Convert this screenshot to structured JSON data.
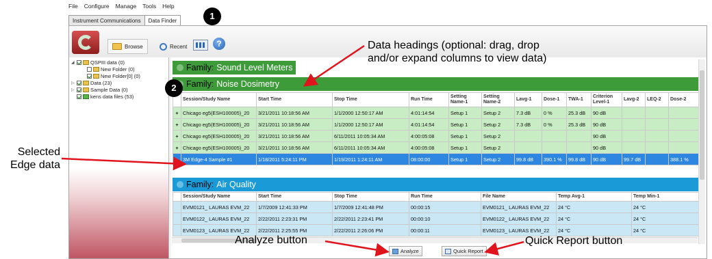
{
  "menu": [
    "File",
    "Configure",
    "Manage",
    "Tools",
    "Help"
  ],
  "tabs": [
    "Instrument Communications",
    "Data Finder"
  ],
  "toolbar": {
    "browse": "Browse",
    "recent": "Recent"
  },
  "tree": [
    "QSPIII data (0)",
    "New Folder (0)",
    "New Folder[0] (0)",
    "Data (23)",
    "Sample Data (0)",
    "kens data files (53)"
  ],
  "families": {
    "sound": {
      "prefix": "Family:",
      "name": "Sound Level Meters"
    },
    "noise": {
      "prefix": "Family:",
      "name": "Noise Dosimetry"
    },
    "air": {
      "prefix": "Family:",
      "name": "Air Quality"
    }
  },
  "noise_table": {
    "headers": [
      "Session/Study Name",
      "Start Time",
      "Stop Time",
      "Run Time",
      "Setting Name-1",
      "Setting Name-2",
      "Lavg-1",
      "Dose-1",
      "TWA-1",
      "Criterion Level-1",
      "Lavg-2",
      "LEQ-2",
      "Dose-2"
    ],
    "rows": [
      [
        "+",
        "Chicago eg5(ESH100005)_20",
        "3/21/2011 10:18:56 AM",
        "1/1/2000 12:50:17 AM",
        "4:01:14:54",
        "Setup 1",
        "Setup 2",
        "7.3 dB",
        "0 %",
        "25.3 dB",
        "90 dB",
        "",
        "",
        ""
      ],
      [
        "+",
        "Chicago eg5(ESH100005)_20",
        "3/21/2011 10:18:56 AM",
        "1/1/2000 12:50:17 AM",
        "4:01:14:54",
        "Setup 1",
        "Setup 2",
        "7.3 dB",
        "0 %",
        "25.3 dB",
        "90 dB",
        "",
        "",
        ""
      ],
      [
        "+",
        "Chicago eg5(ESH100005)_20",
        "3/21/2011 10:18:56 AM",
        "6/11/2011 10:05:34 AM",
        "4:00:05:08",
        "Setup 1",
        "Setup 2",
        "",
        "",
        "",
        "90 dB",
        "",
        "",
        ""
      ],
      [
        "+",
        "Chicago eg5(ESH100005)_20",
        "3/21/2011 10:18:56 AM",
        "6/11/2011 10:05:34 AM",
        "4:00:05:08",
        "Setup 1",
        "Setup 2",
        "",
        "",
        "",
        "90 dB",
        "",
        "",
        ""
      ],
      [
        "",
        "3M Edge-4 Sample #1",
        "1/18/2011 5:24:11 PM",
        "1/19/2011 1:24:11 AM",
        "08:00:00",
        "Setup 1",
        "Setup 2",
        "99.8 dB",
        "390.1 %",
        "99.8 dB",
        "90 dB",
        "99.7 dB",
        "",
        "388.1 %"
      ]
    ]
  },
  "air_table": {
    "headers": [
      "Session/Study Name",
      "Start Time",
      "Stop Time",
      "Run Time",
      "File Name",
      "Temp Avg-1",
      "Temp Min-1"
    ],
    "rows": [
      [
        "",
        "EVM0121_ LAURAS EVM_22",
        "1/7/2009 12:41:33 PM",
        "1/7/2009 12:41:48 PM",
        "00:00:15",
        "EVM0121_ LAURAS EVM_22",
        "24 °C",
        "24 °C"
      ],
      [
        "",
        "EVM0122_ LAURAS EVM_22",
        "2/22/2011 2:23:31 PM",
        "2/22/2011 2:23:41 PM",
        "00:00:10",
        "EVM0122_ LAURAS EVM_22",
        "24 °C",
        "24 °C"
      ],
      [
        "",
        "EVM0123_ LAURAS EVM_22",
        "2/22/2011 2:25:55 PM",
        "2/22/2011 2:26:06 PM",
        "00:00:11",
        "EVM0123_ LAURAS EVM_22",
        "24 °C",
        "24 °C"
      ]
    ]
  },
  "buttons": {
    "analyze": "Analyze",
    "quick_report": "Quick Report"
  },
  "callouts": {
    "badge1": "1",
    "badge2": "2",
    "headings_line1": "Data headings (optional:  drag, drop",
    "headings_line2": "and/or expand columns to view data)",
    "selected_line1": "Selected",
    "selected_line2": "Edge data",
    "analyze": "Analyze button",
    "quick_report": "Quick Report button"
  },
  "colors": {
    "noise_row": "#c8ecc3",
    "selected_row": "#2d86e0",
    "air_row": "#c9e7f5",
    "family_green": "#3d9b3a",
    "family_blue": "#1a9bd8",
    "arrow": "#e0141c"
  }
}
